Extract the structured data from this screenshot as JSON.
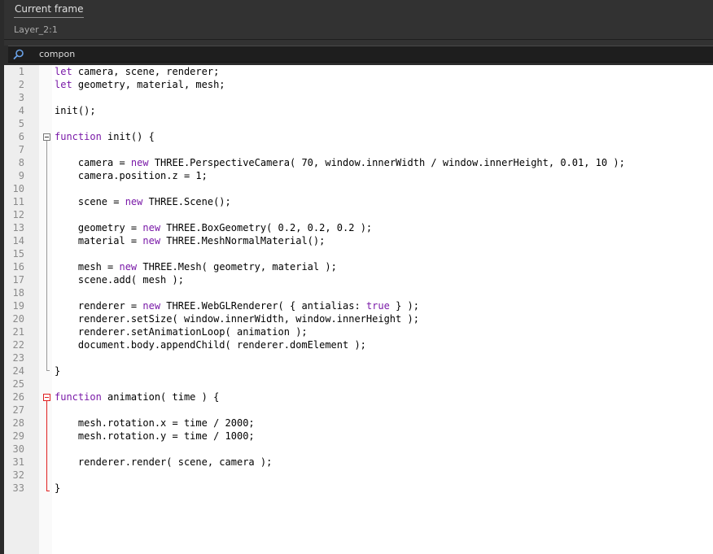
{
  "header": {
    "tab_label": "Current frame",
    "layer_label": "Layer_2:1"
  },
  "search": {
    "value": "compon",
    "icon": "search-icon"
  },
  "colors": {
    "keyword": "#7a1aa8",
    "fold_active": "#e02020",
    "background": "#2b2b2b"
  },
  "editor": {
    "lines": [
      {
        "n": "1",
        "code": "let camera, scene, renderer;"
      },
      {
        "n": "2",
        "code": "let geometry, material, mesh;"
      },
      {
        "n": "3",
        "code": ""
      },
      {
        "n": "4",
        "code": "init();"
      },
      {
        "n": "5",
        "code": ""
      },
      {
        "n": "6",
        "code": "function init() {"
      },
      {
        "n": "7",
        "code": ""
      },
      {
        "n": "8",
        "code": "    camera = new THREE.PerspectiveCamera( 70, window.innerWidth / window.innerHeight, 0.01, 10 );"
      },
      {
        "n": "9",
        "code": "    camera.position.z = 1;"
      },
      {
        "n": "10",
        "code": ""
      },
      {
        "n": "11",
        "code": "    scene = new THREE.Scene();"
      },
      {
        "n": "12",
        "code": ""
      },
      {
        "n": "13",
        "code": "    geometry = new THREE.BoxGeometry( 0.2, 0.2, 0.2 );"
      },
      {
        "n": "14",
        "code": "    material = new THREE.MeshNormalMaterial();"
      },
      {
        "n": "15",
        "code": ""
      },
      {
        "n": "16",
        "code": "    mesh = new THREE.Mesh( geometry, material );"
      },
      {
        "n": "17",
        "code": "    scene.add( mesh );"
      },
      {
        "n": "18",
        "code": ""
      },
      {
        "n": "19",
        "code": "    renderer = new THREE.WebGLRenderer( { antialias: true } );"
      },
      {
        "n": "20",
        "code": "    renderer.setSize( window.innerWidth, window.innerHeight );"
      },
      {
        "n": "21",
        "code": "    renderer.setAnimationLoop( animation );"
      },
      {
        "n": "22",
        "code": "    document.body.appendChild( renderer.domElement );"
      },
      {
        "n": "23",
        "code": ""
      },
      {
        "n": "24",
        "code": "}"
      },
      {
        "n": "25",
        "code": ""
      },
      {
        "n": "26",
        "code": "function animation( time ) {"
      },
      {
        "n": "27",
        "code": ""
      },
      {
        "n": "28",
        "code": "    mesh.rotation.x = time / 2000;"
      },
      {
        "n": "29",
        "code": "    mesh.rotation.y = time / 1000;"
      },
      {
        "n": "30",
        "code": ""
      },
      {
        "n": "31",
        "code": "    renderer.render( scene, camera );"
      },
      {
        "n": "32",
        "code": ""
      },
      {
        "n": "33",
        "code": "}"
      }
    ]
  }
}
